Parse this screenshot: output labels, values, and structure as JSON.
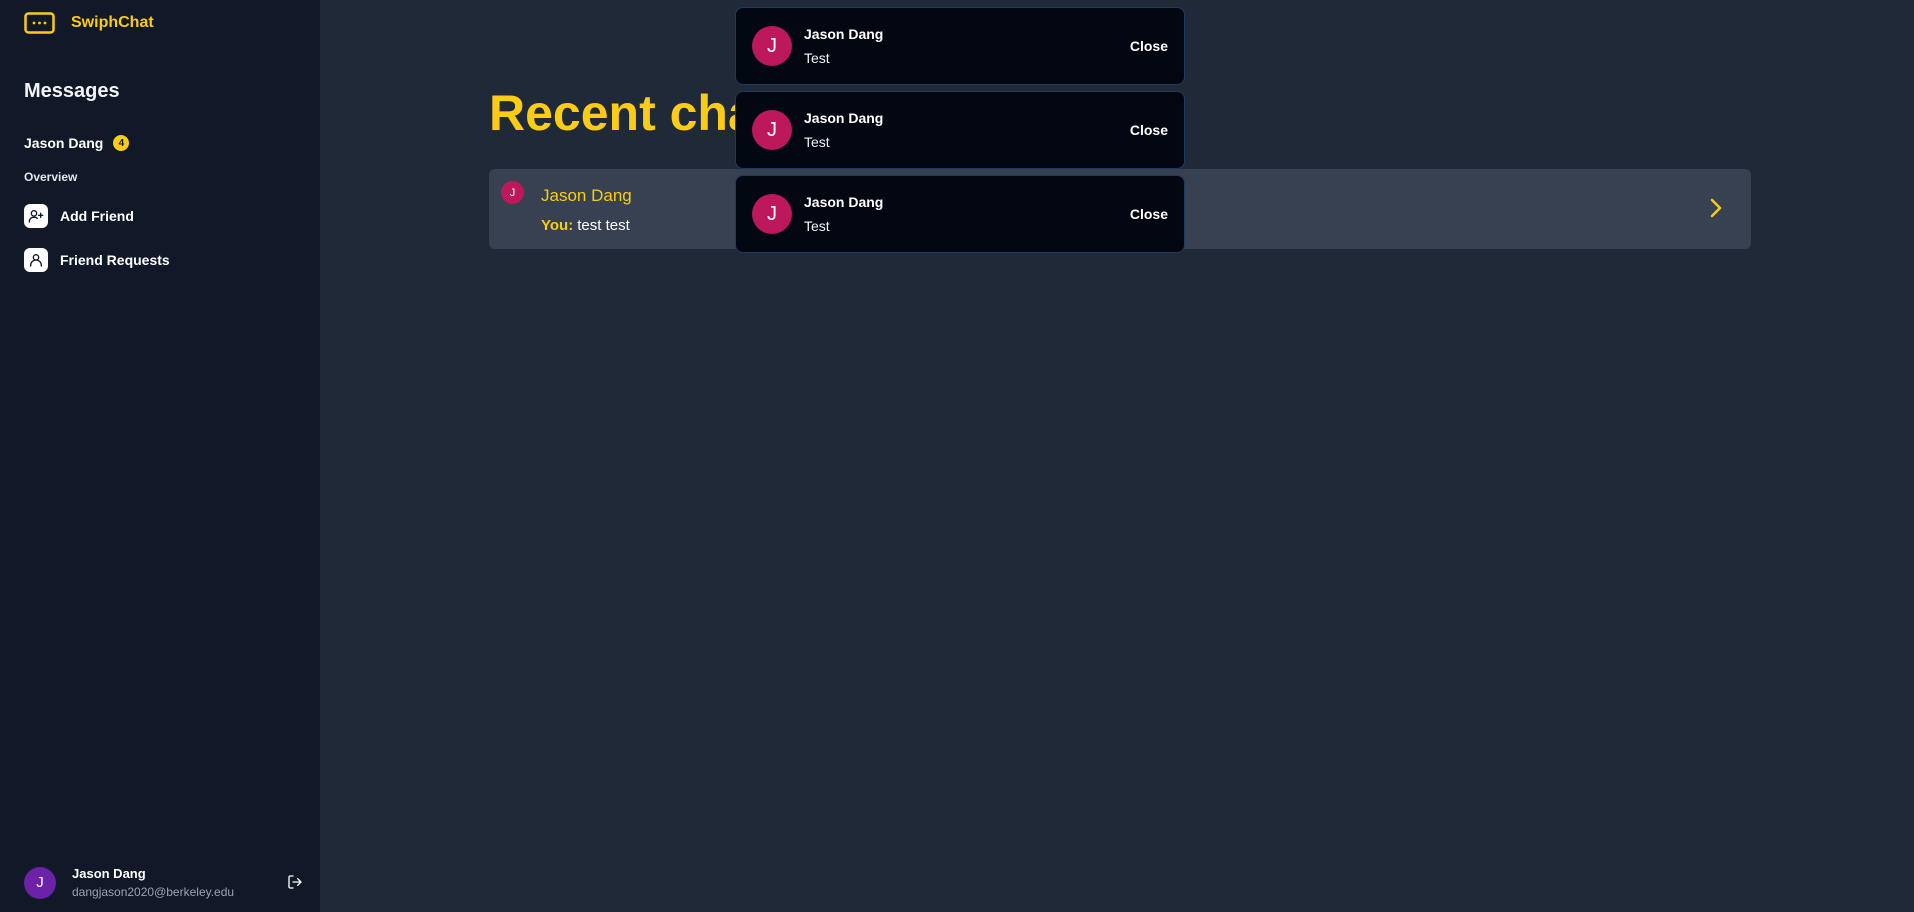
{
  "app": {
    "name": "SwiphChat",
    "accent_color": "#facc15",
    "logo_icon": "message-dots-icon"
  },
  "sidebar": {
    "section_title": "Messages",
    "chats": [
      {
        "name": "Jason Dang",
        "unread": "4"
      }
    ],
    "overview_label": "Overview",
    "nav": [
      {
        "label": "Add Friend",
        "icon": "user-plus-icon"
      },
      {
        "label": "Friend Requests",
        "icon": "user-icon"
      }
    ],
    "profile": {
      "initial": "J",
      "name": "Jason Dang",
      "email": "dangjason2020@berkeley.edu",
      "signout_icon": "sign-out-icon"
    }
  },
  "main": {
    "title": "Recent chats",
    "recent_chats": [
      {
        "initial": "J",
        "name": "Jason Dang",
        "sender_label": "You:",
        "preview": "test test",
        "chevron_icon": "chevron-right-icon"
      }
    ]
  },
  "toasts": [
    {
      "initial": "J",
      "name": "Jason Dang",
      "message": "Test",
      "close_label": "Close"
    },
    {
      "initial": "J",
      "name": "Jason Dang",
      "message": "Test",
      "close_label": "Close"
    },
    {
      "initial": "J",
      "name": "Jason Dang",
      "message": "Test",
      "close_label": "Close"
    }
  ]
}
